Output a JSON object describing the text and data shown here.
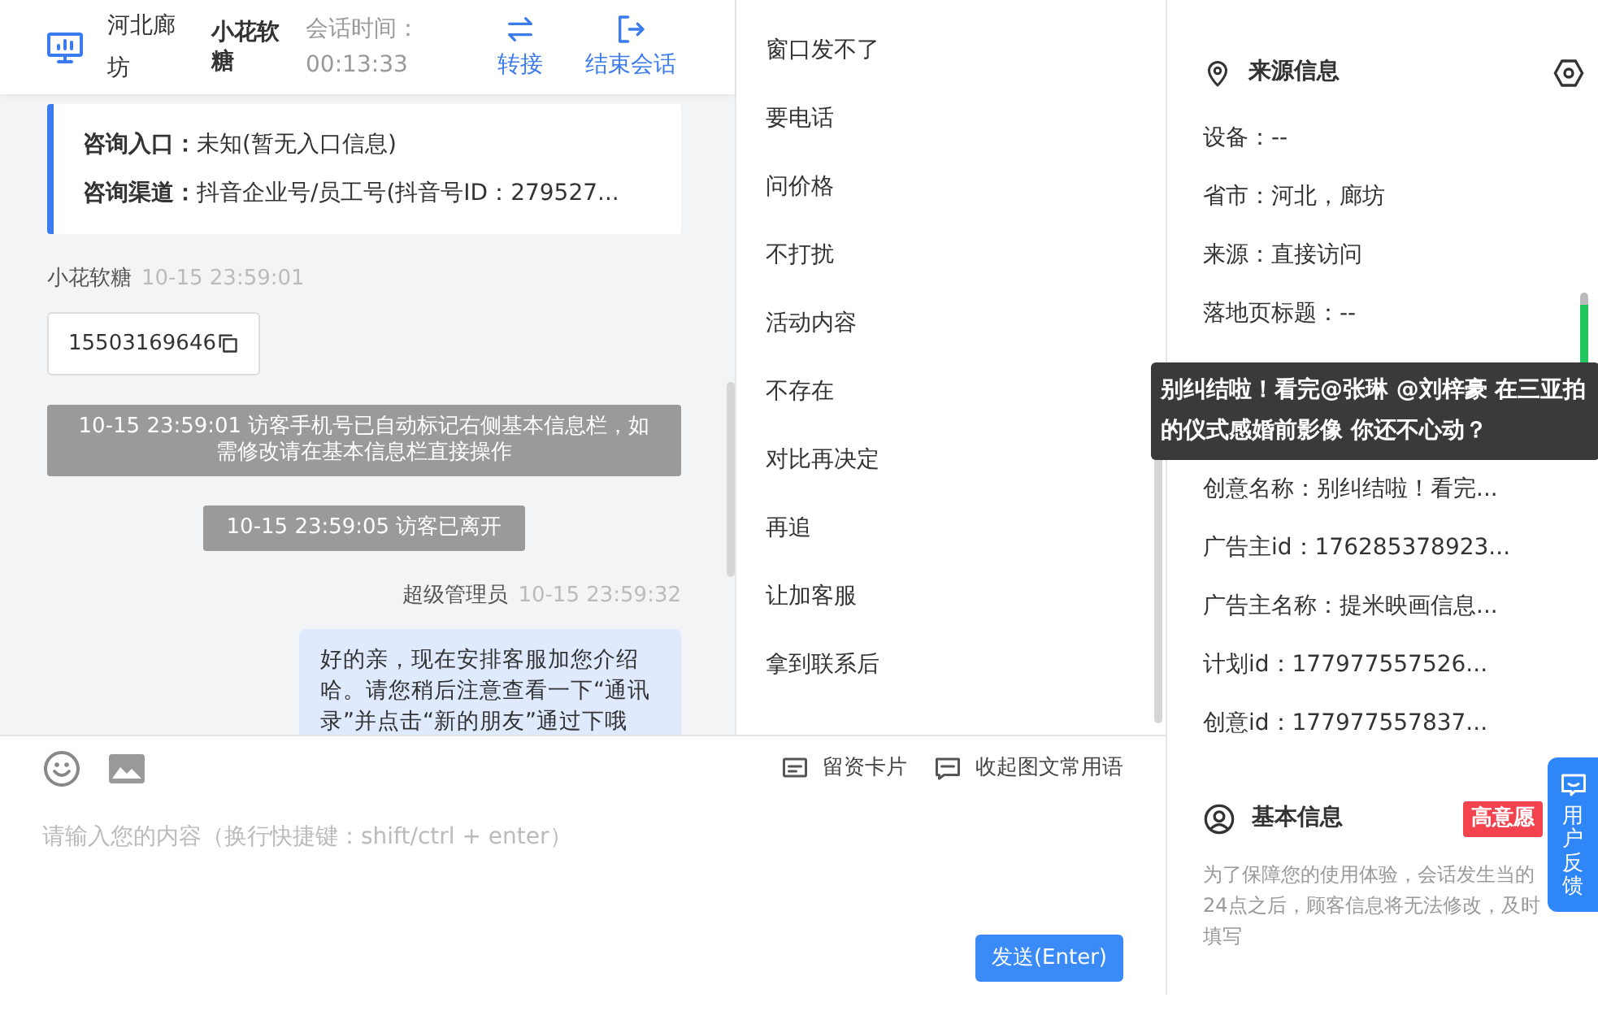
{
  "header": {
    "location": "河北廊坊",
    "visitor": "小花软糖",
    "session_time_label": "会话时间：",
    "session_time": "00:13:33",
    "actions": [
      {
        "label": "转接",
        "kind": "transfer"
      },
      {
        "label": "结束会话",
        "kind": "end"
      }
    ]
  },
  "consult_info": [
    {
      "label": "咨询入口：",
      "value": "未知(暂无入口信息)"
    },
    {
      "label": "咨询渠道：",
      "value": "抖音企业号/员工号(抖音号ID：279527..."
    }
  ],
  "messages": [
    {
      "kind": "visitor",
      "sender": "小花软糖",
      "time": "10-15 23:59:01",
      "text": "15503169646"
    },
    {
      "kind": "system",
      "text": "10-15 23:59:01 访客手机号已自动标记右侧基本信息栏，如需修改请在基本信息栏直接操作"
    },
    {
      "kind": "system",
      "text": "10-15 23:59:05 访客已离开"
    },
    {
      "kind": "agent",
      "sender": "超级管理员",
      "time": "10-15 23:59:32",
      "text": "好的亲，现在安排客服加您介绍哈。请您稍后注意查看一下“通讯录”并点击“新的朋友”通过下哦"
    }
  ],
  "quick_phrases": [
    "窗口发不了",
    "要电话",
    "问价格",
    "不打扰",
    "活动内容",
    "不存在",
    "对比再决定",
    "再追",
    "让加客服",
    "拿到联系后"
  ],
  "composer": {
    "tools": [
      {
        "label": "留资卡片",
        "kind": "card"
      },
      {
        "label": "收起图文常用语",
        "kind": "collapse"
      }
    ],
    "placeholder": "请输入您的内容（换行快捷键：shift/ctrl + enter）",
    "send": "发送(Enter)"
  },
  "source_info": {
    "title": "来源信息",
    "rows_top": [
      "设备：--",
      "省市：河北，廊坊",
      "来源：直接访问",
      "落地页标题：--"
    ],
    "rows_bottom": [
      "创意名称：别纠结啦！看完...",
      "广告主id：176285378923...",
      "广告主名称：提米映画信息...",
      "计划id：177977557526...",
      "创意id：177977557837..."
    ]
  },
  "tooltip": "别纠结啦！看完@张琳 @刘梓豪 在三亚拍的仪式感婚前影像 你还不心动？",
  "basic_info": {
    "title": "基本信息",
    "tag": "高意愿",
    "note": "为了保障您的使用体验，会话发生当的24点之后，顾客信息将无法修改，及时填写"
  },
  "feedback": "用户反馈"
}
